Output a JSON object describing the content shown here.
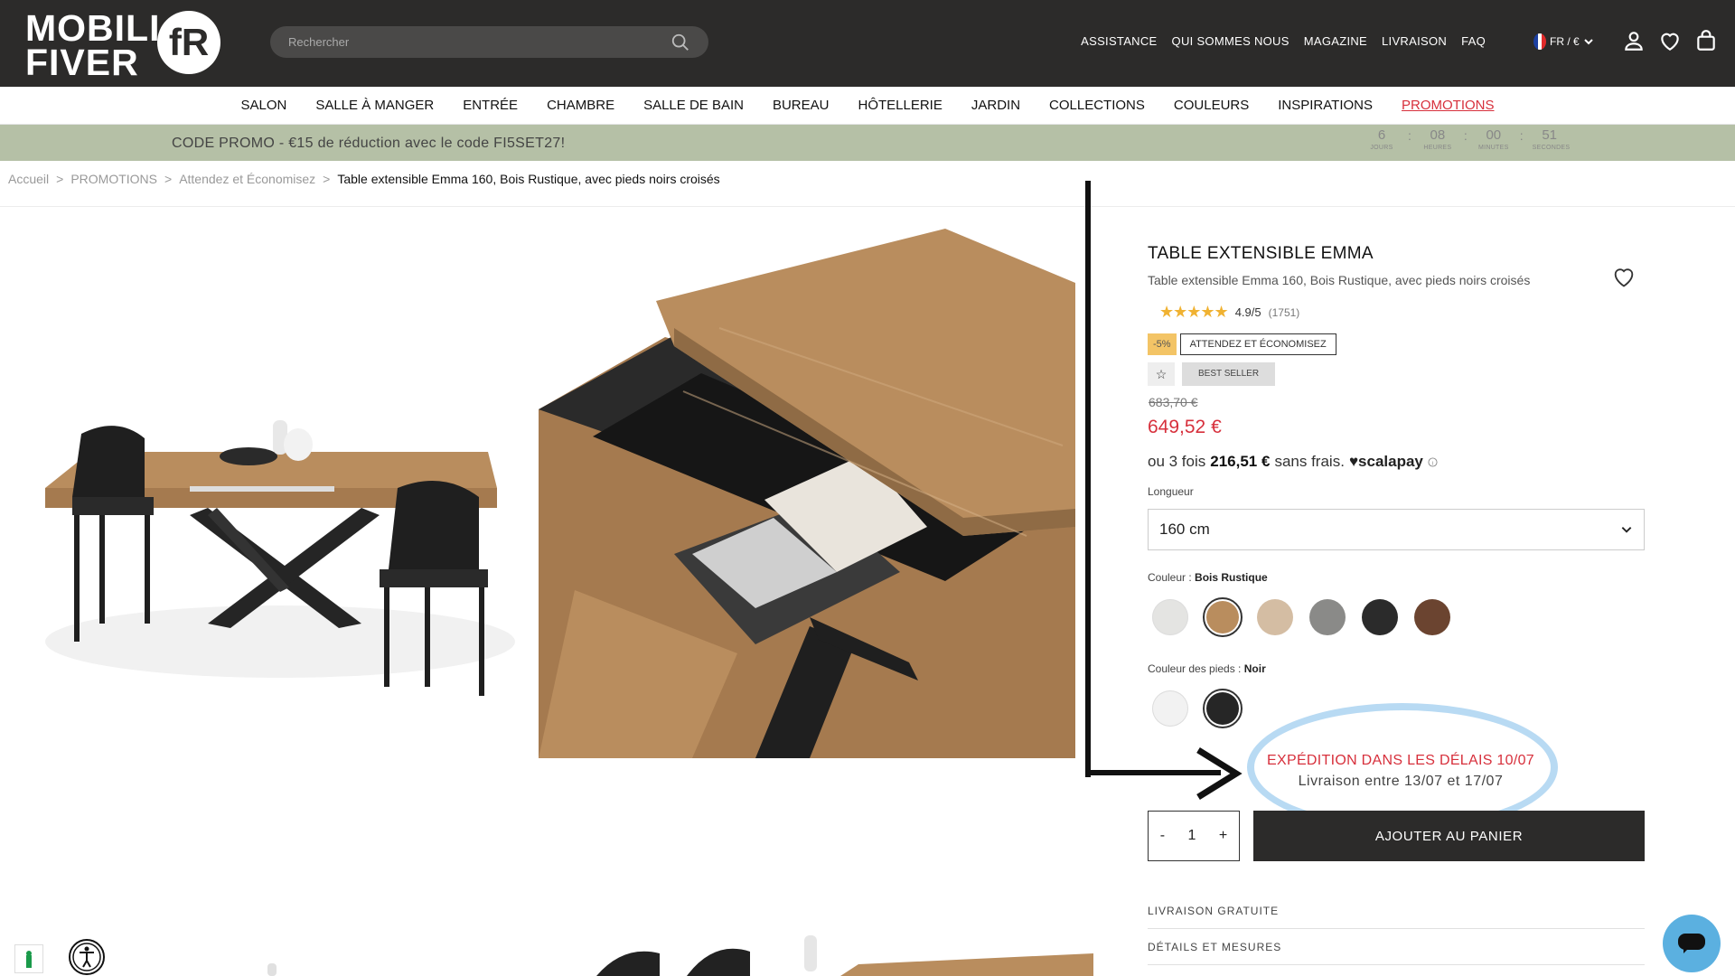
{
  "header": {
    "logo_line1": "MOBILI",
    "logo_line2": "FIVER",
    "logo_mark": "fR",
    "search_placeholder": "Rechercher",
    "links": [
      "ASSISTANCE",
      "QUI SOMMES NOUS",
      "MAGAZINE",
      "LIVRAISON",
      "FAQ"
    ],
    "lang": "FR / €",
    "icons": [
      "user-icon",
      "heart-icon",
      "bag-icon"
    ]
  },
  "nav": {
    "items": [
      "SALON",
      "SALLE À MANGER",
      "ENTRÉE",
      "CHAMBRE",
      "SALLE DE BAIN",
      "BUREAU",
      "HÔTELLERIE",
      "JARDIN",
      "COLLECTIONS",
      "COULEURS",
      "INSPIRATIONS",
      "PROMOTIONS"
    ]
  },
  "promo": {
    "text": "CODE PROMO - €15 de réduction avec le code FI5SET27!",
    "countdown": [
      {
        "value": "6",
        "unit": "JOURS"
      },
      {
        "value": "08",
        "unit": "HEURES"
      },
      {
        "value": "00",
        "unit": "MINUTES"
      },
      {
        "value": "51",
        "unit": "SECONDES"
      }
    ]
  },
  "breadcrumb": {
    "items": [
      "Accueil",
      "PROMOTIONS",
      "Attendez et Économisez"
    ],
    "current": "Table extensible Emma 160, Bois Rustique, avec pieds noirs croisés"
  },
  "product": {
    "title": "TABLE EXTENSIBLE EMMA",
    "subtitle": "Table extensible Emma 160, Bois Rustique, avec pieds noirs croisés",
    "stars": "★★★★★",
    "rating": "4.9/5",
    "reviews": "(1751)",
    "badge_discount": "-5%",
    "badge_attend": "ATTENDEZ ET ÉCONOMISEZ",
    "badge_best": "BEST SELLER",
    "old_price": "683,70 €",
    "price": "649,52 €",
    "instal_prefix": "ou 3 fois",
    "instal_amount": "216,51 €",
    "instal_suffix": "sans frais.",
    "instal_brand": "♥scalapay",
    "length_label": "Longueur",
    "length_value": "160 cm",
    "color_label": "Couleur :",
    "color_value": "Bois Rustique",
    "colors": [
      "#e4e4e2",
      "#b98d5e",
      "#d4bda3",
      "#8a8a88",
      "#2b2b2b",
      "#6b4430"
    ],
    "legs_label": "Couleur des pieds :",
    "legs_value": "Noir",
    "leg_colors": [
      "#f2f2f2",
      "#262626"
    ],
    "ship_line1": "EXPÉDITION DANS LES DÉLAIS 10/07",
    "ship_line2": "Livraison entre 13/07 et 17/07",
    "qty_minus": "-",
    "qty": "1",
    "qty_plus": "+",
    "add_to_cart": "AJOUTER AU PANIER",
    "accordion": [
      "LIVRAISON GRATUITE",
      "DÉTAILS ET MESURES"
    ]
  }
}
